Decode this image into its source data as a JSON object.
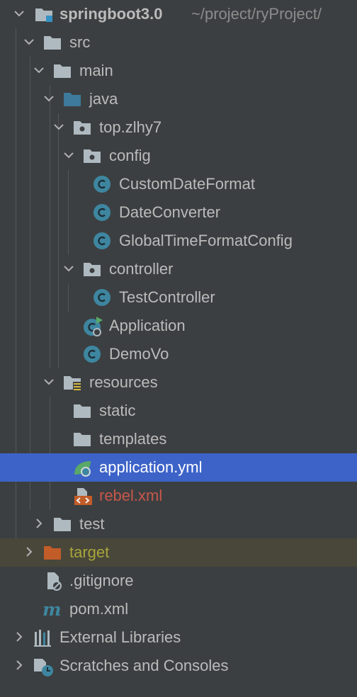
{
  "project": {
    "name": "springboot3.0",
    "path": "~/project/ryProject/"
  },
  "tree": {
    "src": "src",
    "main": "main",
    "java": "java",
    "package": "top.zlhy7",
    "config": "config",
    "config_classes": [
      "CustomDateFormat",
      "DateConverter",
      "GlobalTimeFormatConfig"
    ],
    "controller": "controller",
    "controller_classes": [
      "TestController"
    ],
    "application": "Application",
    "demovo": "DemoVo",
    "resources": "resources",
    "static": "static",
    "templates": "templates",
    "application_yml": "application.yml",
    "rebel_xml": "rebel.xml",
    "test": "test",
    "target": "target",
    "gitignore": ".gitignore",
    "pom": "pom.xml",
    "external_libraries": "External Libraries",
    "scratches": "Scratches and Consoles"
  },
  "icons": {
    "folder": "folder-icon",
    "source_root": "source-folder-icon",
    "package": "package-icon",
    "resources_root": "resources-folder-icon",
    "class": "class-icon",
    "spring_boot_app": "spring-boot-application-icon",
    "yaml_spring": "spring-yaml-icon",
    "xml": "xml-file-icon",
    "ignore": "ignore-file-icon",
    "maven": "maven-icon",
    "libraries": "libraries-icon",
    "scratches": "scratches-icon"
  },
  "colors": {
    "background": "#3c3f41",
    "selected": "#3d63c8",
    "excluded_row": "#48473a",
    "folder": "#aeb9c0",
    "source_folder": "#3d7a9b",
    "class_icon": "#3e86a0",
    "excluded_folder": "#c25c28",
    "excluded_text": "#a9a53a",
    "xml_text": "#c7574b"
  }
}
